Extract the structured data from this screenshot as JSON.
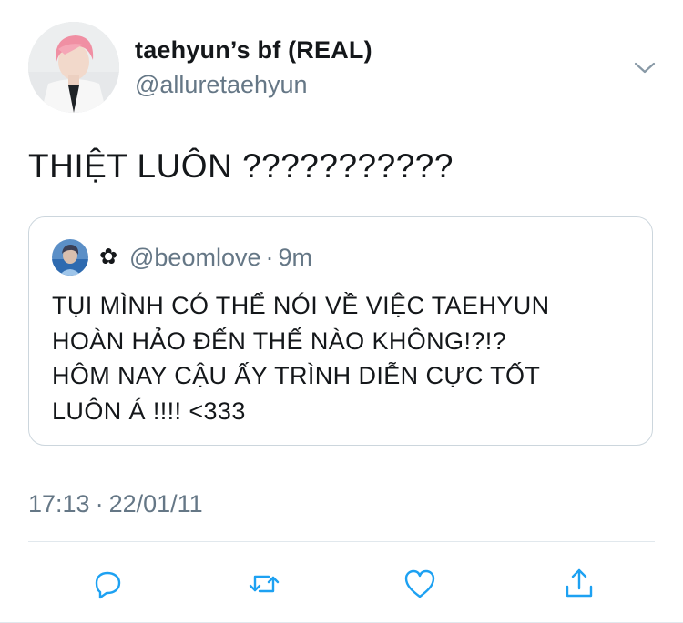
{
  "author": {
    "display_name": "taehyun’s bf (REAL)",
    "handle": "@alluretaehyun",
    "avatar_icon": "profile-photo-pink-hair"
  },
  "tweet": {
    "text": "THIỆT LUÔN ???????????",
    "timestamp": "17:13",
    "separator": "·",
    "date": "22/01/11"
  },
  "quoted_tweet": {
    "name_icon": "✿",
    "handle": "@beomlove",
    "separator": "·",
    "time_ago": "9m",
    "lines": [
      "TỤI MÌNH CÓ THỂ NÓI VỀ VIỆC TAEHYUN",
      "HOÀN HẢO ĐẾN THẾ NÀO KHÔNG!?!?",
      "HÔM NAY CẬU ẤY TRÌNH DIỄN CỰC TỐT",
      "LUÔN Á !!!! <333"
    ]
  },
  "actions": [
    "reply-icon",
    "retweet-icon",
    "like-icon",
    "share-icon"
  ],
  "colors": {
    "text_primary": "#14171a",
    "text_secondary": "#657786",
    "border": "#ccd6dd",
    "icon": "#1da1f2"
  }
}
